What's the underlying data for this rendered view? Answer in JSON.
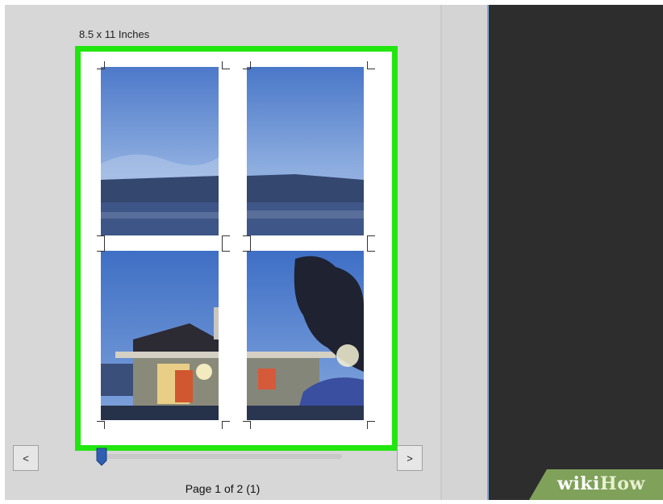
{
  "print_preview": {
    "paper_size_label": "8.5 x 11 Inches",
    "page_label": "Page 1 of 2 (1)",
    "prev_label": "<",
    "next_label": ">",
    "page_slider_fraction": 0.03
  },
  "watermark": {
    "wiki": "wiki",
    "how": "How"
  },
  "colors": {
    "highlight_border": "#22e60f",
    "dark_pane": "#2d2d2d",
    "slider_thumb": "#2f5fb3",
    "watermark_bg": "#7fa15a"
  },
  "icons": [
    "crop-mark-icon",
    "slider-thumb-icon"
  ]
}
